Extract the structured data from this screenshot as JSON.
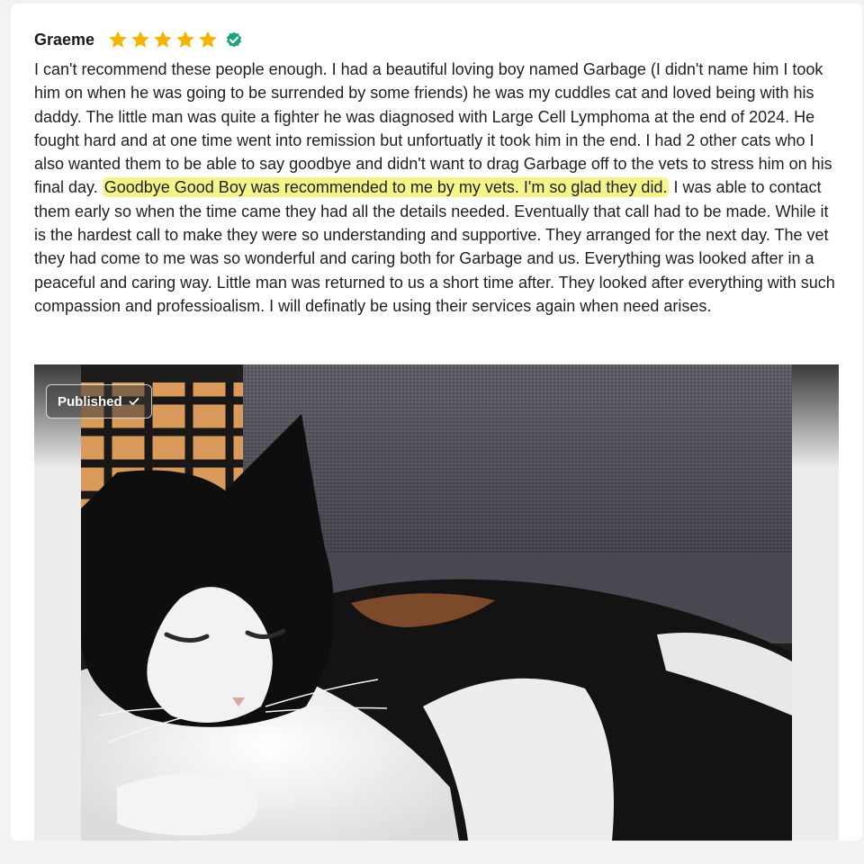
{
  "review": {
    "reviewer_name": "Graeme",
    "rating": 5,
    "star_color": "#f5b400",
    "verified_color": "#1aa37a",
    "text_before": "I can't recommend these people enough. I had a beautiful loving boy named Garbage (I didn't name him I took him on when he was going to be surrended by some friends) he was my cuddles cat and loved being with his daddy. The little man was quite a fighter he was diagnosed with Large Cell Lymphoma at the end of 2024. He fought hard and at one time went into remission but unfortuatly it took him in the end. I had 2 other cats who I also wanted them to be able to say goodbye and didn't want to drag Garbage off to the vets to stress him on his final day. ",
    "text_highlighted": "Goodbye Good Boy was recommended to me by my vets. I'm so glad they did.",
    "highlight_color": "#f5f58a",
    "text_after": " I was able to contact them early so when the time came they had all the details needed. Eventually that call had to be made. While it is the hardest call to make they were so understanding and supportive. They arranged for the next day. The vet they had come to me was so wonderful and caring both for Garbage and us. Everything was looked after in a peaceful and caring way. Little man was returned to us a short time after. They looked after everything with such compassion and professioalism. I will definatly be using their services again when need arises."
  },
  "photo": {
    "status_label": "Published"
  }
}
